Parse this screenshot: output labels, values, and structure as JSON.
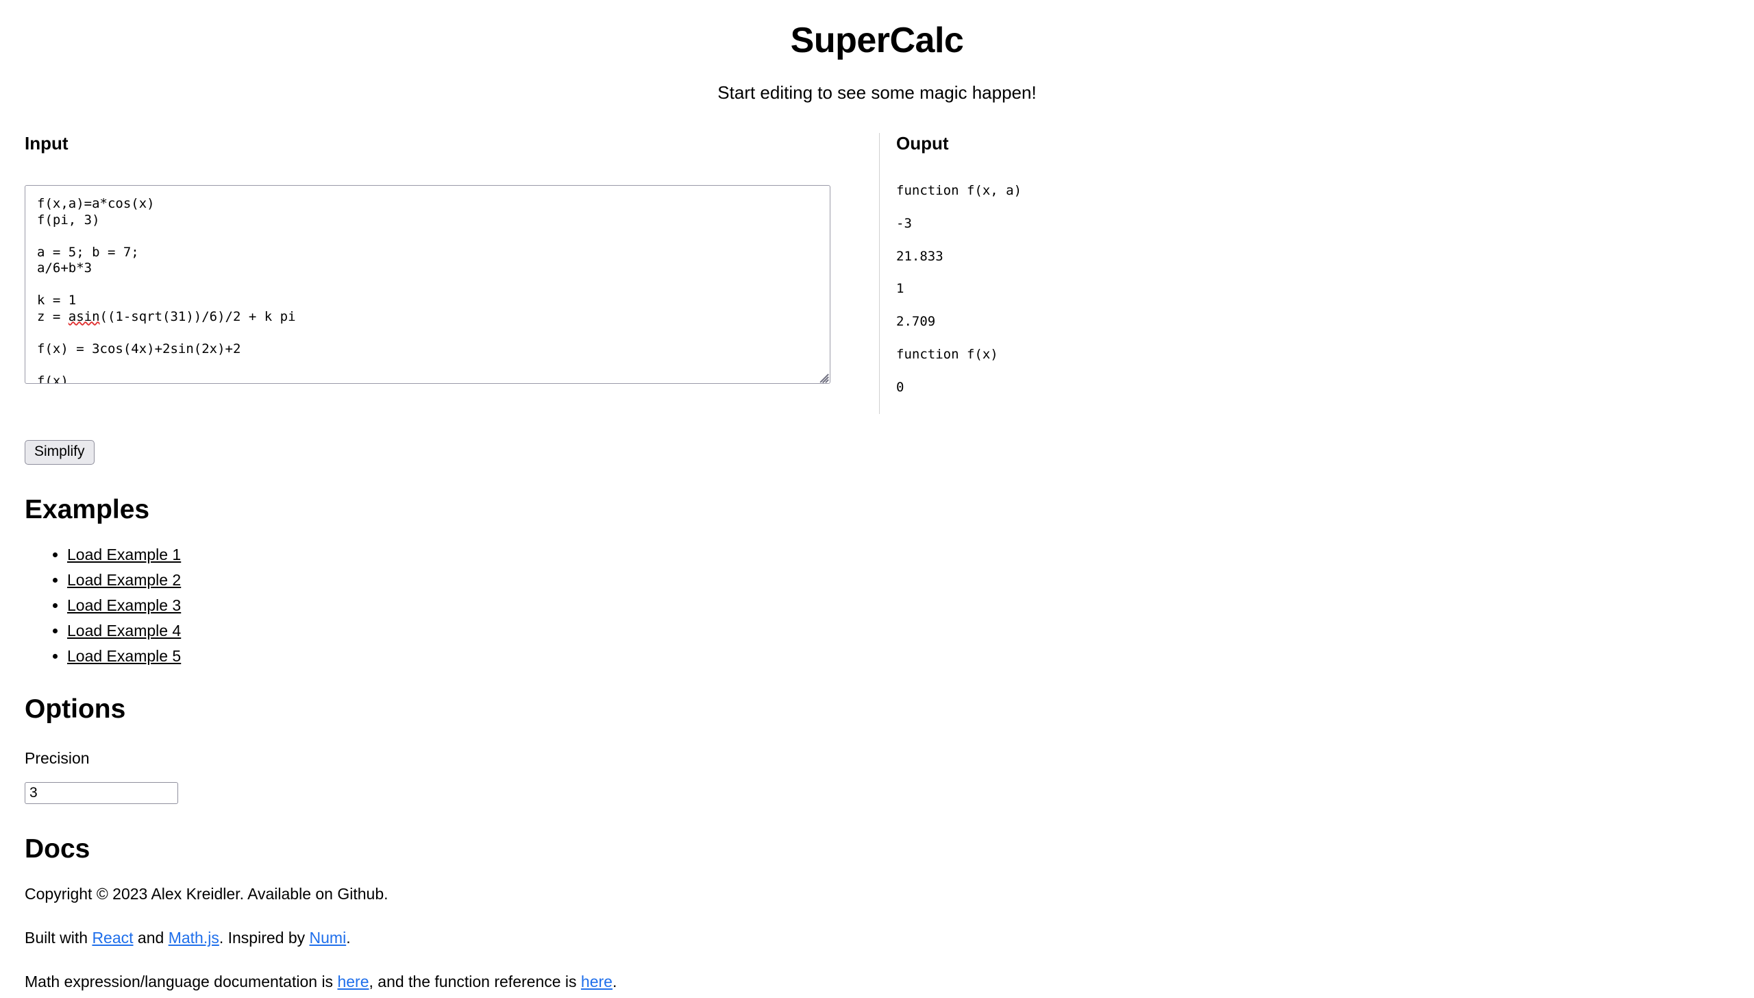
{
  "header": {
    "title": "SuperCalc",
    "subtitle": "Start editing to see some magic happen!"
  },
  "input_pane": {
    "heading": "Input",
    "textarea_value": "f(x,a)=a*cos(x)\nf(pi, 3)\n\na = 5; b = 7;\na/6+b*3\n\nk = 1\nz = asin((1-sqrt(31))/6)/2 + k pi\n\nf(x) = 3cos(4x)+2sin(2x)+2\n\nf(x)",
    "lines": [
      "f(x,a)=a*cos(x)",
      "f(pi, 3)",
      "",
      "a = 5; b = 7;",
      "a/6+b*3",
      "",
      "k = 1",
      "z = asin((1-sqrt(31))/6)/2 + k pi",
      "",
      "f(x) = 3cos(4x)+2sin(2x)+2",
      "",
      "f(x)"
    ],
    "spellcheck_token": "asin",
    "resize_handle": "resize-grip-icon"
  },
  "output_pane": {
    "heading": "Ouput",
    "lines": [
      "function f(x, a)",
      "-3",
      "21.833",
      "1",
      "2.709",
      "function f(x)",
      "0"
    ]
  },
  "actions": {
    "simplify_label": "Simplify"
  },
  "examples": {
    "heading": "Examples",
    "items": [
      "Load Example 1",
      "Load Example 2",
      "Load Example 3",
      "Load Example 4",
      "Load Example 5"
    ]
  },
  "options": {
    "heading": "Options",
    "precision_label": "Precision",
    "precision_value": "3"
  },
  "docs": {
    "heading": "Docs",
    "copyright": "Copyright © 2023 Alex Kreidler. Available on Github.",
    "built_with_prefix": "Built with ",
    "react_link": "React",
    "built_with_mid": " and ",
    "mathjs_link": "Math.js",
    "inspired_prefix": ". Inspired by ",
    "numi_link": "Numi",
    "inspired_suffix": ".",
    "doc_prefix": "Math expression/language documentation is ",
    "doc_link_1": "here",
    "doc_mid": ", and the function reference is ",
    "doc_link_2": "here",
    "doc_suffix": "."
  },
  "colors": {
    "link": "#1f6feb",
    "border": "#9a9aa8",
    "button_bg": "#e9e9ed",
    "divider": "#d0d0d0",
    "spell_error": "#e03030"
  }
}
